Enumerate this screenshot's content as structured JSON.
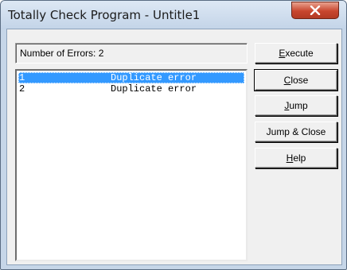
{
  "window": {
    "title": "Totally Check Program - Untitle1"
  },
  "summary": {
    "errors_text": "Number of Errors: 2"
  },
  "errors": [
    {
      "num": "1",
      "message": "Duplicate error",
      "selected": true
    },
    {
      "num": "2",
      "message": "Duplicate error",
      "selected": false
    }
  ],
  "buttons": {
    "execute": {
      "mnemonic": "E",
      "rest": "xecute"
    },
    "close": {
      "mnemonic": "C",
      "rest": "lose"
    },
    "jump": {
      "mnemonic": "J",
      "rest": "ump"
    },
    "jump_close": {
      "label": "Jump & Close"
    },
    "help": {
      "mnemonic": "H",
      "rest": "elp"
    }
  },
  "colors": {
    "selection": "#3399ff",
    "close_button": "#c8462e"
  },
  "icons": {
    "close": "close-icon"
  }
}
